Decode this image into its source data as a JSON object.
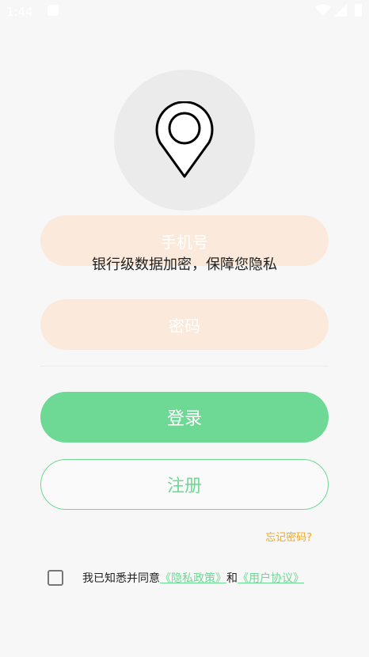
{
  "status_bar": {
    "time": "1:44"
  },
  "header": {
    "subtitle": "银行级数据加密，保障您隐私"
  },
  "form": {
    "phone_placeholder": "手机号",
    "password_placeholder": "密码",
    "login_label": "登录",
    "register_label": "注册",
    "forgot_label": "忘记密码?"
  },
  "agreement": {
    "prefix": "我已知悉并同意",
    "privacy_link": "《隐私政策》",
    "connector": "和",
    "user_link": "《用户协议》",
    "checked": false
  },
  "colors": {
    "accent": "#6dd994",
    "field_bg": "#fbeadb",
    "forgot": "#f2a81c",
    "logo_bg": "#ebebeb"
  },
  "icons": {
    "logo": "location-pin-icon",
    "status": [
      "notification-icon",
      "wifi-icon",
      "signal-icon",
      "battery-icon"
    ]
  }
}
